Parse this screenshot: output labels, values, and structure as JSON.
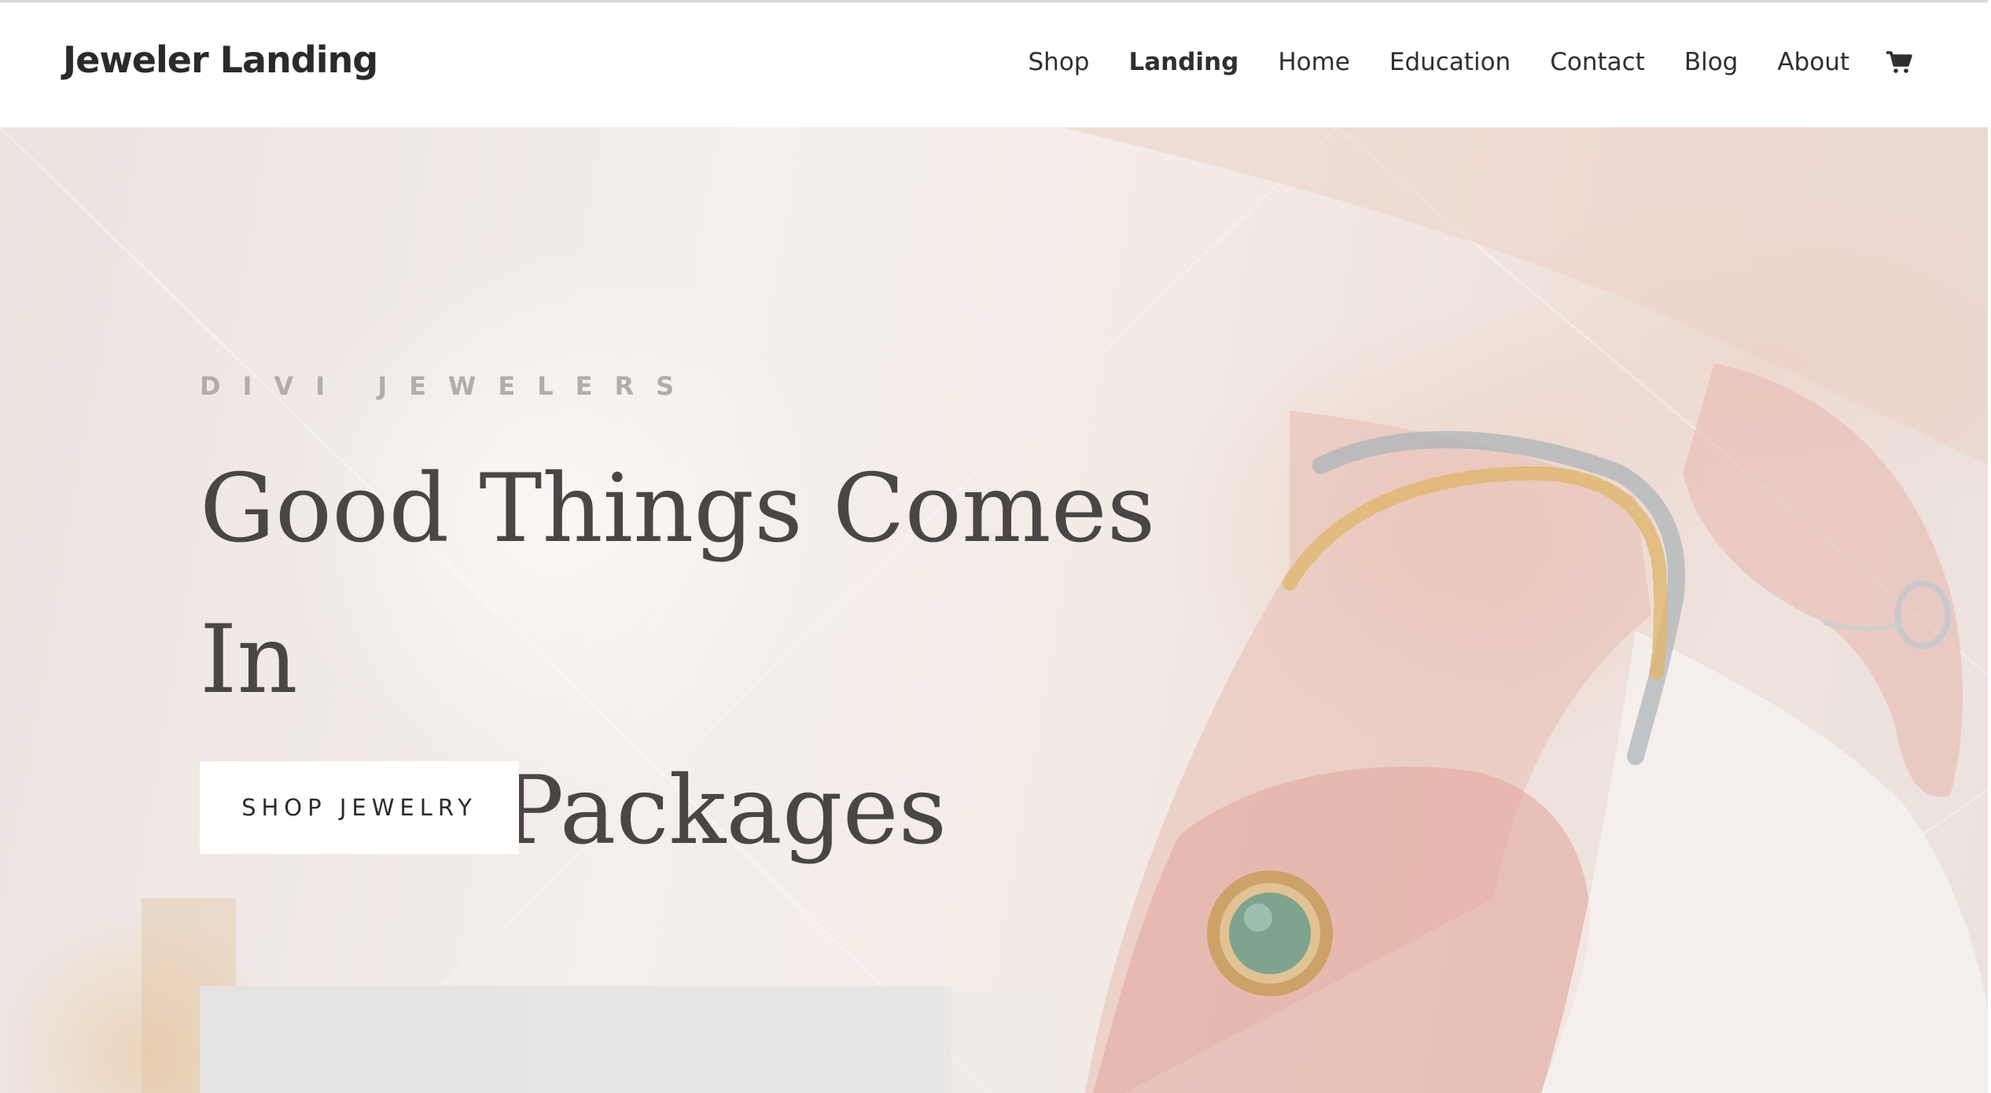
{
  "header": {
    "logo": "Jeweler Landing",
    "nav": [
      "Shop",
      "Landing",
      "Home",
      "Education",
      "Contact",
      "Blog",
      "About"
    ],
    "active_nav": "Landing"
  },
  "hero": {
    "eyebrow": "DIVI JEWELERS",
    "headline_line1": "Good Things Comes In",
    "headline_line2": "Small Packages",
    "cta_label": "SHOP JEWELRY"
  },
  "colors": {
    "text_dark": "#2a2a2a",
    "eyebrow": "#b2adaa",
    "headline": "#4a4645",
    "button_bg": "#ffffff"
  },
  "icons": {
    "cart": "cart-icon"
  }
}
